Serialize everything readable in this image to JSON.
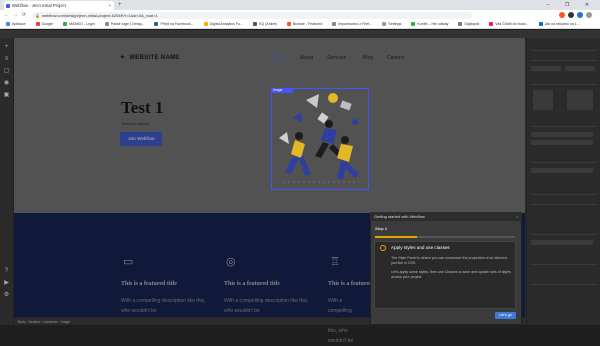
{
  "browser": {
    "tab_title": "Webflow - Jenn Initial Project",
    "tab_close": "×",
    "new_tab": "+",
    "window_controls": "– ❐ ✕",
    "back": "←",
    "forward": "→",
    "reload": "⟳",
    "lock": "🔒",
    "url": "webflow.com/design/jenn-initial-project-6204ff?r=1&sf=0&_vcat=1"
  },
  "bookmarks": [
    {
      "label": "Aplikace",
      "color": "#4285f4"
    },
    {
      "label": "Google",
      "color": "#ea4335"
    },
    {
      "label": "MAMKO - Login",
      "color": "#34a853"
    },
    {
      "label": "Pakké login | Desig...",
      "color": "#888888"
    },
    {
      "label": "Přejít na Facebook...",
      "color": "#3b5998"
    },
    {
      "label": "Digital Analytics Fu...",
      "color": "#f4b400"
    },
    {
      "label": "SQ (Anket)",
      "color": "#555555"
    },
    {
      "label": "Browse - Featured",
      "color": "#ff5722"
    },
    {
      "label": "Importováno z Firef...",
      "color": "#888888"
    },
    {
      "label": "Settings",
      "color": "#999999"
    },
    {
      "label": "Kontin – Hle odkaty",
      "color": "#34a853"
    },
    {
      "label": "Digitopoli",
      "color": "#777777"
    },
    {
      "label": "Vila Čiňaři do budo...",
      "color": "#e91e63"
    },
    {
      "label": "Jak na reklamu na L...",
      "color": "#0077b5"
    }
  ],
  "site": {
    "logo_star": "✦",
    "logo": "WEBSITE NAME",
    "nav": [
      "Home",
      "About",
      "Services",
      "Blog",
      "Contact"
    ],
    "heading": "Test 1",
    "lorem": "Testovací stránka",
    "hero_button": "Join Webflow",
    "image_tag": "Image",
    "features": [
      {
        "icon": "▭",
        "title": "This is a featured title",
        "desc": "With a compelling description like this, who wouldn't be"
      },
      {
        "icon": "◎",
        "title": "This is a featured title",
        "desc": "With a compelling description like this, who wouldn't be"
      },
      {
        "icon": "♖",
        "title": "This is a featured title",
        "desc": "With a compelling description like this, who wouldn't be"
      }
    ]
  },
  "editor": {
    "bottom_bar": "Body  ›  Section  ›  Container  ›  Image"
  },
  "onboarding": {
    "header": "Getting started with Webflow",
    "close": "×",
    "step": "Step 2",
    "progress": 0.3,
    "title": "Apply styles and use classes",
    "text1": "The Style Panel is where you can customize the properties of an element, just like in CSS.",
    "text2": "Let's apply some styles, then use Classes to save and update sets of styles across your project.",
    "button": "Let's go"
  },
  "colors": {
    "accent": "#4353ff",
    "onboarding_accent": "#e8a500",
    "button_blue": "#3d7bd6",
    "features_bg": "#101939"
  }
}
